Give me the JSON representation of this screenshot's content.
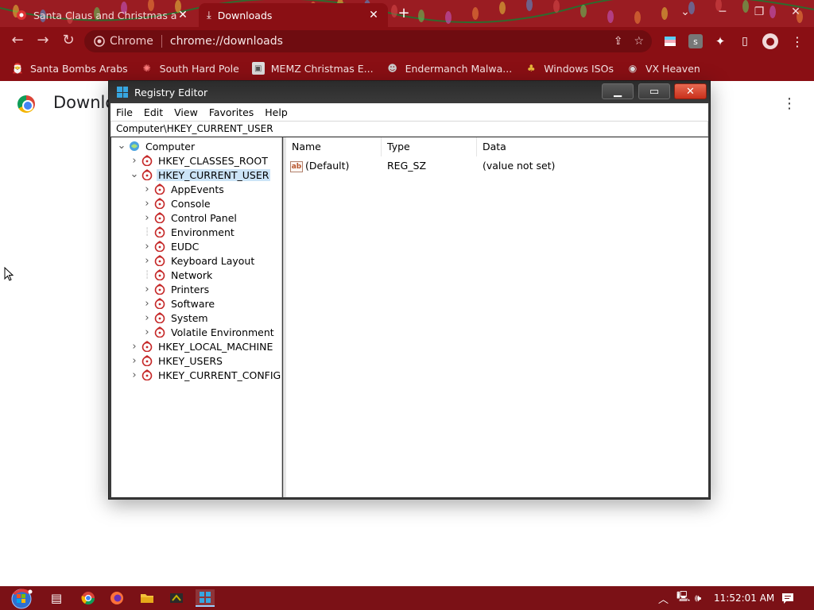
{
  "browser": {
    "tabs": [
      {
        "title": "Santa Claus and Christmas at th",
        "active": false
      },
      {
        "title": "Downloads",
        "active": true
      }
    ],
    "new_tab": "+",
    "omnibox": {
      "chip": "Chrome",
      "url": "chrome://downloads"
    },
    "bookmarks": [
      {
        "label": "Santa Bombs Arabs",
        "icon": "santa-icon"
      },
      {
        "label": "South Hard Pole",
        "icon": "snowflake-icon"
      },
      {
        "label": "MEMZ Christmas E...",
        "icon": "image-icon"
      },
      {
        "label": "Endermanch Malwa...",
        "icon": "mascot-icon"
      },
      {
        "label": "Windows ISOs",
        "icon": "tree-icon"
      },
      {
        "label": "VX Heaven",
        "icon": "globe-icon"
      }
    ]
  },
  "page": {
    "title": "Downloads"
  },
  "regedit": {
    "title": "Registry Editor",
    "menu": [
      "File",
      "Edit",
      "View",
      "Favorites",
      "Help"
    ],
    "address": "Computer\\HKEY_CURRENT_USER",
    "tree": [
      {
        "label": "Computer",
        "level": 0,
        "expander": "expanded",
        "icon": "computer-icon"
      },
      {
        "label": "HKEY_CLASSES_ROOT",
        "level": 1,
        "expander": "collapsed",
        "icon": "hive-icon"
      },
      {
        "label": "HKEY_CURRENT_USER",
        "level": 1,
        "expander": "expanded",
        "icon": "hive-icon",
        "selected": true
      },
      {
        "label": "AppEvents",
        "level": 2,
        "expander": "collapsed",
        "icon": "key-icon"
      },
      {
        "label": "Console",
        "level": 2,
        "expander": "collapsed",
        "icon": "key-icon"
      },
      {
        "label": "Control Panel",
        "level": 2,
        "expander": "collapsed",
        "icon": "key-icon"
      },
      {
        "label": "Environment",
        "level": 2,
        "expander": "none",
        "icon": "key-icon"
      },
      {
        "label": "EUDC",
        "level": 2,
        "expander": "collapsed",
        "icon": "key-icon"
      },
      {
        "label": "Keyboard Layout",
        "level": 2,
        "expander": "collapsed",
        "icon": "key-icon"
      },
      {
        "label": "Network",
        "level": 2,
        "expander": "none",
        "icon": "key-icon"
      },
      {
        "label": "Printers",
        "level": 2,
        "expander": "collapsed",
        "icon": "key-icon"
      },
      {
        "label": "Software",
        "level": 2,
        "expander": "collapsed",
        "icon": "key-icon"
      },
      {
        "label": "System",
        "level": 2,
        "expander": "collapsed",
        "icon": "key-icon"
      },
      {
        "label": "Volatile Environment",
        "level": 2,
        "expander": "collapsed",
        "icon": "key-icon"
      },
      {
        "label": "HKEY_LOCAL_MACHINE",
        "level": 1,
        "expander": "collapsed",
        "icon": "hive-icon"
      },
      {
        "label": "HKEY_USERS",
        "level": 1,
        "expander": "collapsed",
        "icon": "hive-icon"
      },
      {
        "label": "HKEY_CURRENT_CONFIG",
        "level": 1,
        "expander": "collapsed",
        "icon": "hive-icon"
      }
    ],
    "columns": [
      "Name",
      "Type",
      "Data"
    ],
    "values": [
      {
        "name": "(Default)",
        "type": "REG_SZ",
        "data": "(value not set)"
      }
    ]
  },
  "taskbar": {
    "apps": [
      "explorer-view-icon",
      "chrome-icon",
      "firefox-icon",
      "folder-icon",
      "malware-icon",
      "regedit-icon"
    ],
    "clock": "11:52:01 AM"
  },
  "colors": {
    "chrome_frame": "#8a0f14",
    "tree_selection": "#cce4f7",
    "close_button": "#d9432a"
  }
}
